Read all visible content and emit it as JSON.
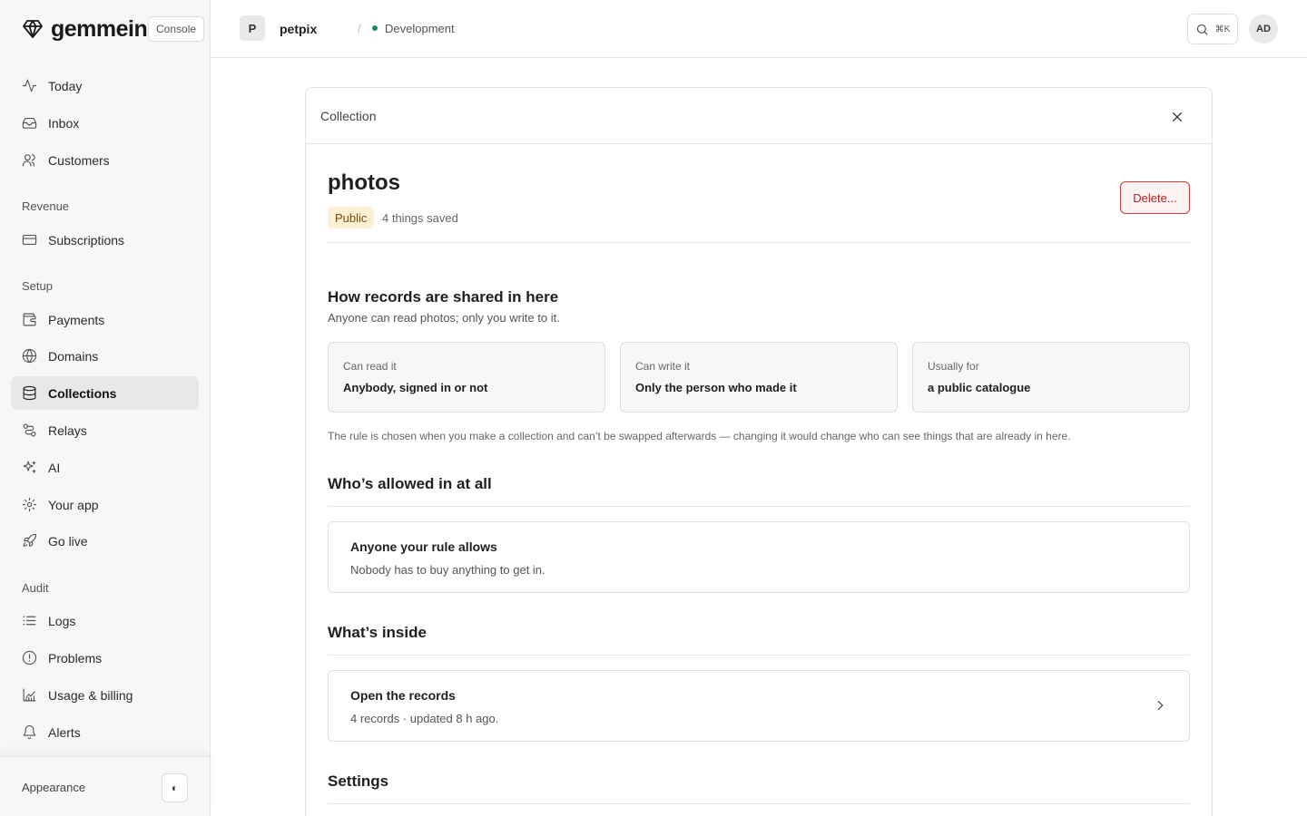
{
  "brand": {
    "name": "gemmein",
    "console_label": "Console"
  },
  "nav": {
    "top": [
      {
        "label": "Today",
        "icon": "activity-icon"
      },
      {
        "label": "Inbox",
        "icon": "inbox-icon"
      },
      {
        "label": "Customers",
        "icon": "users-icon"
      }
    ],
    "revenue_label": "Revenue",
    "revenue": [
      {
        "label": "Subscriptions",
        "icon": "credit-card-icon"
      }
    ],
    "setup_label": "Setup",
    "setup": [
      {
        "label": "Payments",
        "icon": "wallet-icon"
      },
      {
        "label": "Domains",
        "icon": "globe-icon"
      },
      {
        "label": "Collections",
        "icon": "database-icon",
        "active": true
      },
      {
        "label": "Relays",
        "icon": "route-icon"
      },
      {
        "label": "AI",
        "icon": "sparkles-icon"
      },
      {
        "label": "Your app",
        "icon": "gear-icon"
      },
      {
        "label": "Go live",
        "icon": "rocket-icon"
      }
    ],
    "audit_label": "Audit",
    "audit": [
      {
        "label": "Logs",
        "icon": "list-icon"
      },
      {
        "label": "Problems",
        "icon": "alert-circle-icon"
      },
      {
        "label": "Usage & billing",
        "icon": "chart-icon"
      },
      {
        "label": "Alerts",
        "icon": "bell-icon"
      }
    ]
  },
  "footer": {
    "appearance_label": "Appearance",
    "theme_toggle_glyph": "◐"
  },
  "topbar": {
    "project_initial": "P",
    "project_name": "petpix",
    "separator": "/",
    "environment": "Development",
    "search_shortcut": "⌘K",
    "user_initials": "AD",
    "env_color": "#1f8a5a"
  },
  "panel": {
    "title": "Collection",
    "record_name": "photos",
    "badge": "Public",
    "saved_count": "4 things saved",
    "delete_label": "Delete...",
    "sharing": {
      "heading": "How records are shared in here",
      "subtitle": "Anyone can read photos; only you write to it.",
      "cards": [
        {
          "key": "Can read it",
          "value": "Anybody, signed in or not"
        },
        {
          "key": "Can write it",
          "value": "Only the person who made it"
        },
        {
          "key": "Usually for",
          "value": "a public catalogue"
        }
      ],
      "note": "The rule is chosen when you make a collection and can’t be swapped afterwards — changing it would change who can see things that are already in here."
    },
    "access": {
      "heading": "Who’s allowed in at all",
      "title": "Anyone your rule allows",
      "desc": "Nobody has to buy anything to get in."
    },
    "inside": {
      "heading": "What’s inside",
      "title": "Open the records",
      "desc": "4 records · updated 8 h ago."
    },
    "settings": {
      "heading": "Settings"
    }
  },
  "colors": {
    "accent_badge_bg": "#fcefd3",
    "danger": "#b42323",
    "active_nav_bg": "#e8e8e8"
  }
}
